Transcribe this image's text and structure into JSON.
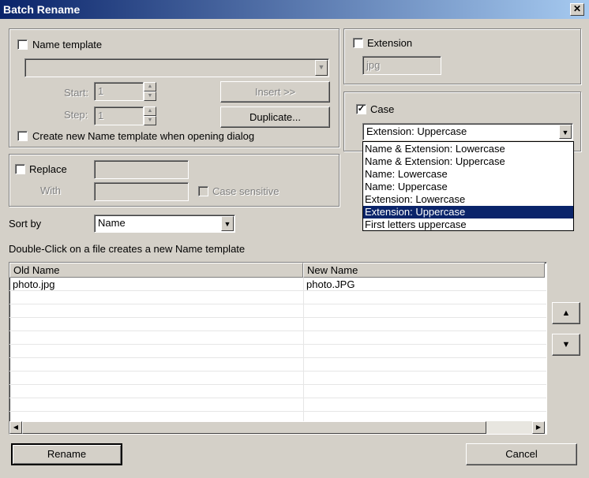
{
  "window": {
    "title": "Batch Rename",
    "close_glyph": "✕"
  },
  "name_template": {
    "label": "Name template",
    "checked": false,
    "start_label": "Start:",
    "start_value": "1",
    "step_label": "Step:",
    "step_value": "1",
    "insert_label": "Insert >>",
    "duplicate_label": "Duplicate...",
    "create_new_label": "Create new Name template when opening dialog"
  },
  "replace": {
    "label": "Replace",
    "with_label": "With",
    "case_sensitive_label": "Case sensitive"
  },
  "extension": {
    "label": "Extension",
    "value": "jpg"
  },
  "case": {
    "label": "Case",
    "checked_glyph": "✓",
    "selected": "Extension: Uppercase",
    "options": [
      "Name & Extension: Lowercase",
      "Name & Extension: Uppercase",
      "Name: Lowercase",
      "Name: Uppercase",
      "Extension: Lowercase",
      "Extension: Uppercase",
      "First letters uppercase"
    ],
    "selected_index": 5
  },
  "sort": {
    "label": "Sort by",
    "value": "Name"
  },
  "hint": "Double-Click on a file creates a new Name template",
  "table": {
    "columns": [
      "Old Name",
      "New Name"
    ],
    "rows": [
      {
        "old": "photo.jpg",
        "new": "photo.JPG"
      }
    ]
  },
  "icons": {
    "dropdown": "▼",
    "up": "▲",
    "down": "▼",
    "left": "◀",
    "right": "▶"
  },
  "buttons": {
    "rename": "Rename",
    "cancel": "Cancel"
  }
}
